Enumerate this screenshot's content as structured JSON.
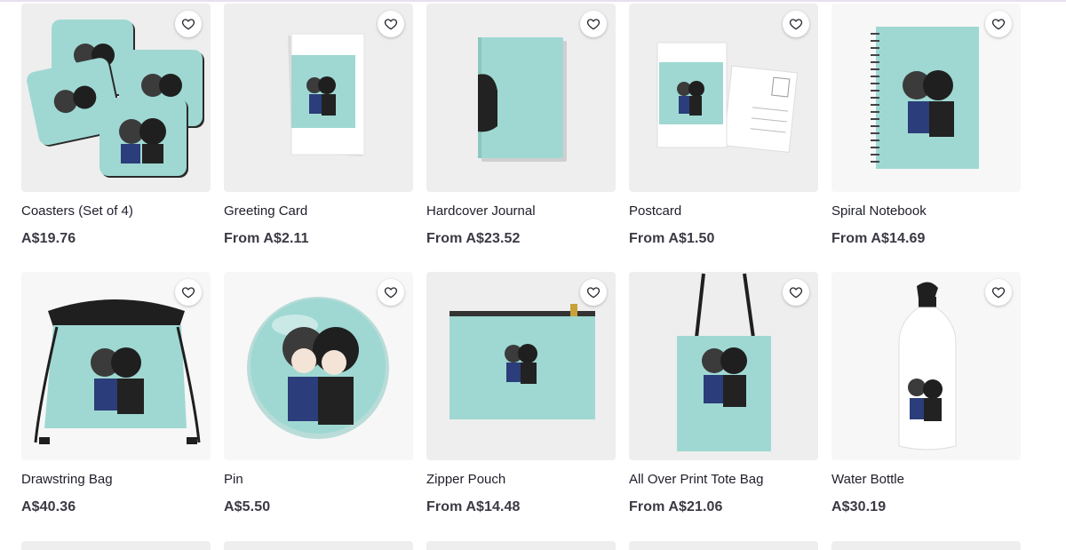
{
  "colors": {
    "mint": "#9fd8d2",
    "price_text": "#3a3a44",
    "title_text": "#1e1e2a",
    "tile_background": "#eeeeee"
  },
  "icons": {
    "favorite": "heart-outline-icon"
  },
  "products": [
    {
      "title": "Coasters (Set of 4)",
      "price": "A$19.76"
    },
    {
      "title": "Greeting Card",
      "price": "From A$2.11"
    },
    {
      "title": "Hardcover Journal",
      "price": "From A$23.52"
    },
    {
      "title": "Postcard",
      "price": "From A$1.50"
    },
    {
      "title": "Spiral Notebook",
      "price": "From A$14.69"
    },
    {
      "title": "Drawstring Bag",
      "price": "A$40.36"
    },
    {
      "title": "Pin",
      "price": "A$5.50"
    },
    {
      "title": "Zipper Pouch",
      "price": "From A$14.48"
    },
    {
      "title": "All Over Print Tote Bag",
      "price": "From A$21.06"
    },
    {
      "title": "Water Bottle",
      "price": "A$30.19"
    }
  ]
}
